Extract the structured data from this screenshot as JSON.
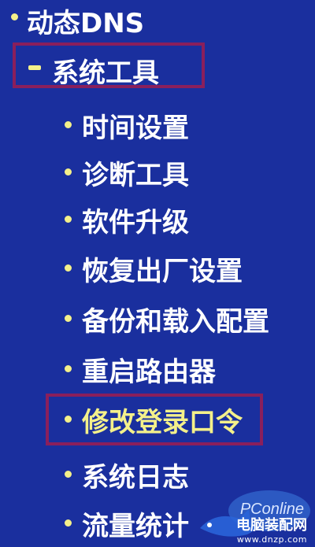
{
  "menu": {
    "ddns_label": "动态DNS",
    "system_tools_label": "系统工具",
    "sub_items": [
      {
        "label": "时间设置"
      },
      {
        "label": "诊断工具"
      },
      {
        "label": "软件升级"
      },
      {
        "label": "恢复出厂设置"
      },
      {
        "label": "备份和载入配置"
      },
      {
        "label": "重启路由器"
      },
      {
        "label": "修改登录口令"
      },
      {
        "label": "系统日志"
      },
      {
        "label": "流量统计"
      }
    ]
  },
  "watermark": {
    "brand": "PConline",
    "site_name": "电脑装配网",
    "url": "www.dnzp.com"
  },
  "colors": {
    "background": "#1a2f9e",
    "text": "#ffffff",
    "bullet": "#f4f08a",
    "highlight_box": "#8a1f5c"
  }
}
